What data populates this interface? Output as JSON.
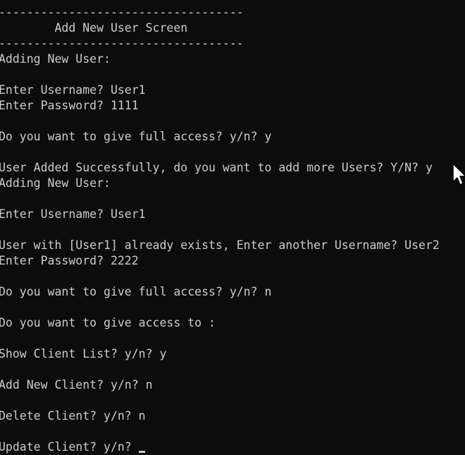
{
  "console": {
    "lines": [
      "-----------------------------------",
      "        Add New User Screen",
      "-----------------------------------",
      "Adding New User:",
      "",
      "Enter Username? User1",
      "Enter Password? 1111",
      "",
      "Do you want to give full access? y/n? y",
      "",
      "User Added Successfully, do you want to add more Users? Y/N? y",
      "Adding New User:",
      "",
      "Enter Username? User1",
      "",
      "User with [User1] already exists, Enter another Username? User2",
      "Enter Password? 2222",
      "",
      "Do you want to give full access? y/n? n",
      "",
      "Do you want to give access to :",
      "",
      "Show Client List? y/n? y",
      "",
      "Add New Client? y/n? n",
      "",
      "Delete Client? y/n? n",
      "",
      "Update Client? y/n? "
    ],
    "background_color": "#0c0c0c",
    "text_color": "#cccccc"
  },
  "pointer": {
    "icon": "mouse-pointer-icon"
  }
}
